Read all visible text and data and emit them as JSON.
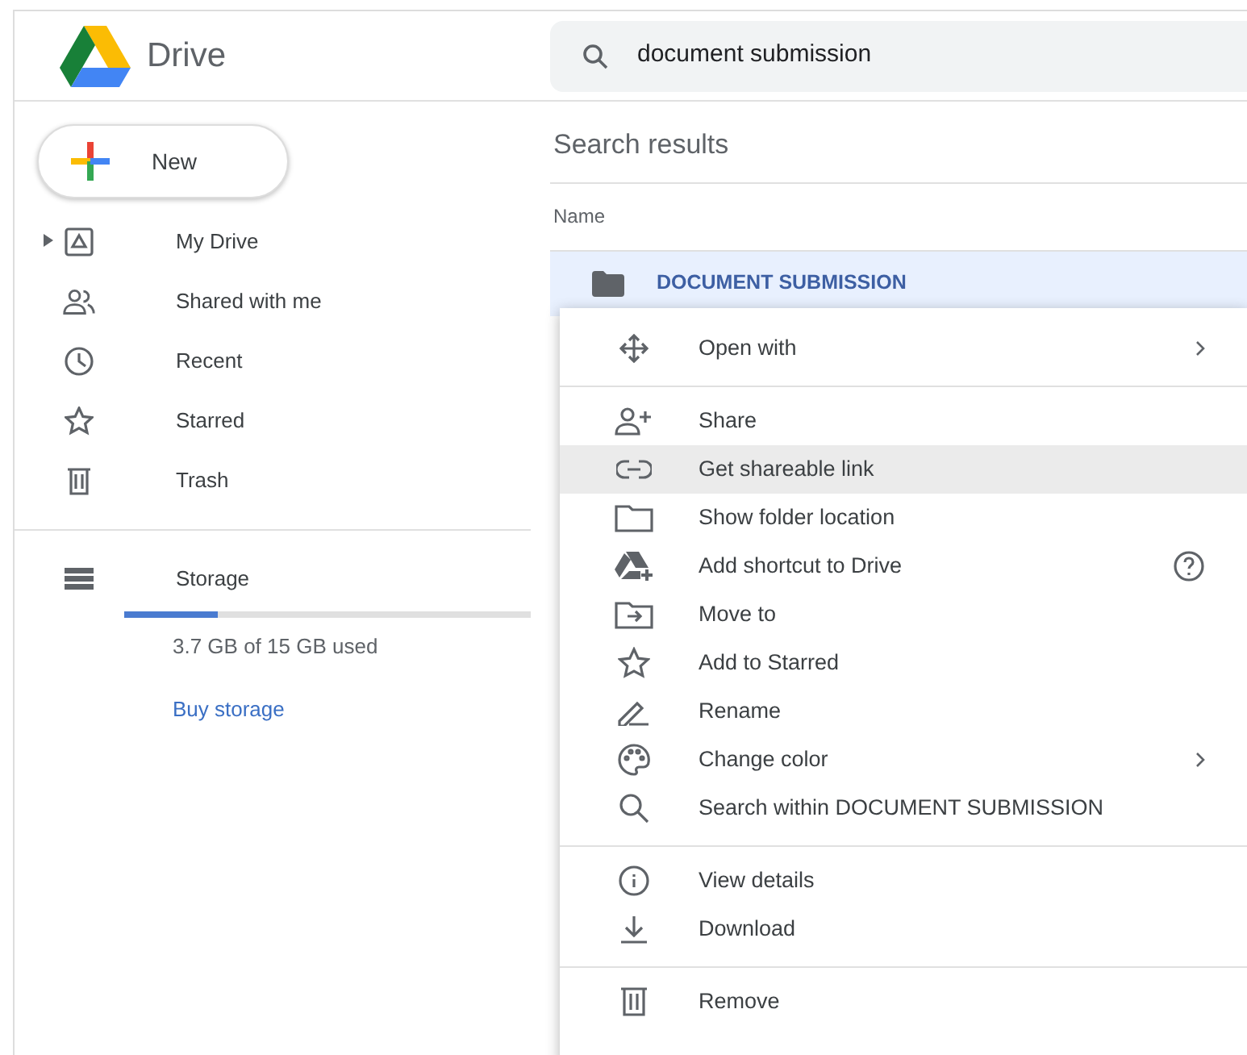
{
  "app": {
    "title": "Drive"
  },
  "search": {
    "value": "document submission"
  },
  "new_button": {
    "label": "New"
  },
  "sidebar": {
    "items": [
      {
        "label": "My Drive",
        "selected": false,
        "expandable": true
      },
      {
        "label": "Shared with me",
        "selected": false,
        "expandable": false
      },
      {
        "label": "Recent",
        "selected": false,
        "expandable": false
      },
      {
        "label": "Starred",
        "selected": false,
        "expandable": false
      },
      {
        "label": "Trash",
        "selected": false,
        "expandable": false
      }
    ]
  },
  "storage": {
    "label": "Storage",
    "level": 0.23,
    "usage": "3.7 GB of 15 GB used",
    "link": "Buy storage"
  },
  "results": {
    "title": "Search results",
    "column": "Name",
    "rows": [
      {
        "name": "DOCUMENT SUBMISSION",
        "selected": true
      }
    ]
  },
  "context_menu": {
    "groups": [
      [
        {
          "label": "Open with",
          "submenu": true,
          "selected": false
        }
      ],
      [
        {
          "label": "Share",
          "submenu": false,
          "selected": false
        },
        {
          "label": "Get shareable link",
          "submenu": false,
          "selected": true
        },
        {
          "label": "Show folder location",
          "submenu": false,
          "selected": false
        },
        {
          "label": "Add shortcut to Drive",
          "submenu": false,
          "selected": false,
          "help": true
        },
        {
          "label": "Move to",
          "submenu": false,
          "selected": false
        },
        {
          "label": "Add to Starred",
          "submenu": false,
          "selected": false
        },
        {
          "label": "Rename",
          "submenu": false,
          "selected": false
        },
        {
          "label": "Change color",
          "submenu": true,
          "selected": false
        },
        {
          "label": "Search within DOCUMENT SUBMISSION",
          "submenu": false,
          "selected": false
        }
      ],
      [
        {
          "label": "View details",
          "submenu": false,
          "selected": false
        },
        {
          "label": "Download",
          "submenu": false,
          "selected": false
        }
      ],
      [
        {
          "label": "Remove",
          "submenu": false,
          "selected": false
        }
      ]
    ]
  }
}
